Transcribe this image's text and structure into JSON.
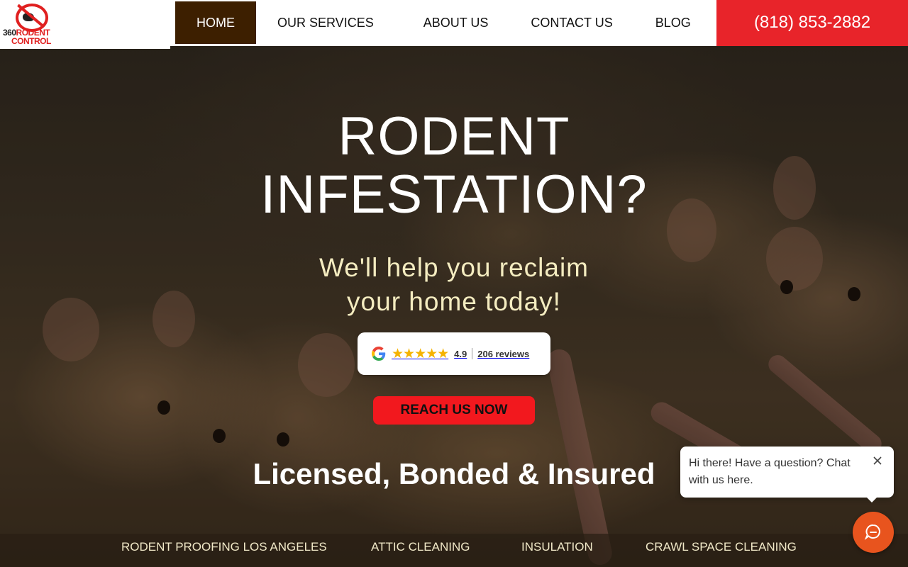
{
  "logo": {
    "line1_num": "360",
    "line1_word": "RODENT",
    "line2": "CONTROL"
  },
  "nav": {
    "home": "HOME",
    "services": "OUR SERVICES",
    "about": "ABOUT US",
    "contact": "CONTACT US",
    "blog": "BLOG"
  },
  "phone": "(818) 853-2882",
  "hero": {
    "headline_line1": "RODENT",
    "headline_line2": "INFESTATION?",
    "sub_line1": "We'll help you reclaim",
    "sub_line2": "your home today!",
    "rating": "4.9",
    "stars": "★★★★★",
    "review_count": "206 reviews",
    "cta": "REACH US NOW",
    "licensed": "Licensed, Bonded & Insured"
  },
  "service_bar": [
    "RODENT PROOFING LOS ANGELES",
    "ATTIC CLEANING",
    "INSULATION",
    "CRAWL SPACE CLEANING"
  ],
  "chat": {
    "message": "Hi there! Have a question? Chat with us here."
  },
  "colors": {
    "brand_red": "#e8242a",
    "home_tab": "#3d1f00",
    "chat_orange": "#e8541e",
    "star_gold": "#f5b301"
  }
}
